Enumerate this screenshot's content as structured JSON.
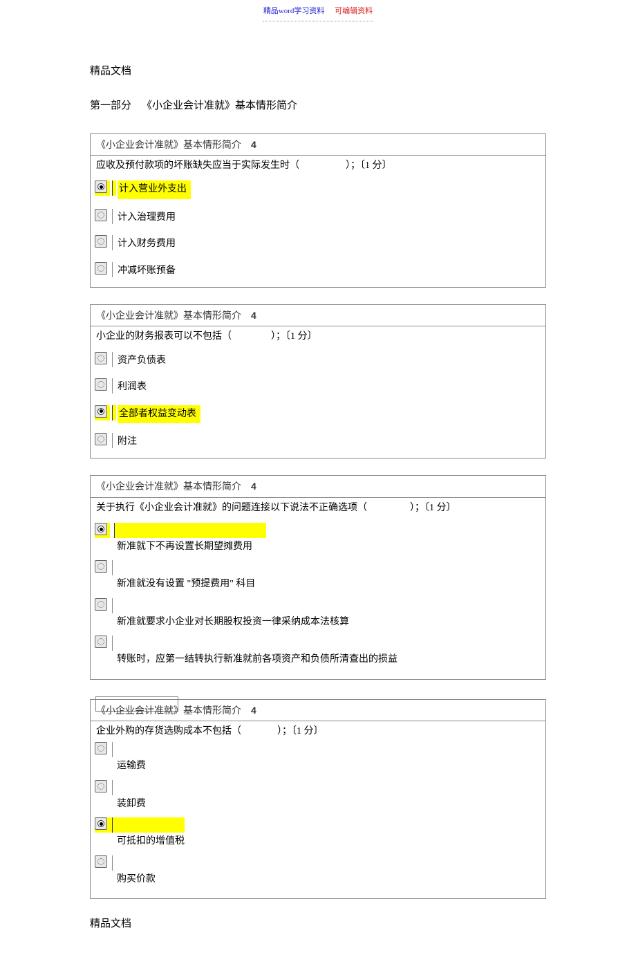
{
  "banner": {
    "left": "精品word学习资料",
    "right": "可编辑资料"
  },
  "doc_header": "精品文档",
  "section_title_prefix": "第一部分",
  "section_title_main": "《小企业会计准就》基本情形简介",
  "doc_footer": "精品文档",
  "questions": [
    {
      "category_label": "《小企业会计准就》基本情形简介",
      "category_badge": "4",
      "text_prefix": "应收及预付款项的坏账缺失应当于实际发生时（",
      "text_suffix": "）；〔1 分〕",
      "layout": "inline",
      "options": [
        {
          "label": "计入营业外支出",
          "selected": true,
          "highlight": true
        },
        {
          "label": "计入治理费用",
          "selected": false,
          "highlight": false
        },
        {
          "label": "计入财务费用",
          "selected": false,
          "highlight": false
        },
        {
          "label": "冲减坏账预备",
          "selected": false,
          "highlight": false
        }
      ]
    },
    {
      "category_label": "《小企业会计准就》基本情形简介",
      "category_badge": "4",
      "text_prefix": "小企业的财务报表可以不包括（",
      "text_suffix": "）；〔1 分〕",
      "layout": "inline",
      "options": [
        {
          "label": "资产负债表",
          "selected": false,
          "highlight": false
        },
        {
          "label": "利润表",
          "selected": false,
          "highlight": false
        },
        {
          "label": "全部者权益变动表",
          "selected": true,
          "highlight": true
        },
        {
          "label": "附注",
          "selected": false,
          "highlight": false
        }
      ]
    },
    {
      "category_label": "《小企业会计准就》基本情形简介",
      "category_badge": "4",
      "text_prefix": "关于执行《小企业会计准就》的问题连接以下说法不正确选项（",
      "text_suffix": "）；〔1 分〕",
      "layout": "stack",
      "options": [
        {
          "label": "新准就下不再设置长期望摊费用",
          "selected": true,
          "highlight": true
        },
        {
          "label": "新准就没有设置 \"预提费用\" 科目",
          "selected": false,
          "highlight": false
        },
        {
          "label": "新准就要求小企业对长期股权投资一律采纳成本法核算",
          "selected": false,
          "highlight": false
        },
        {
          "label": "转账时，应第一结转执行新准就前各项资产和负债所清查出的损益",
          "selected": false,
          "highlight": false
        }
      ]
    },
    {
      "category_label": "《小企业会计准就》基本情形简介",
      "category_badge": "4",
      "text_prefix": "企业外购的存货选购成本不包括（",
      "text_suffix": "）；〔1 分〕",
      "layout": "stack",
      "pre_spacer_box": true,
      "options": [
        {
          "label": "运输费",
          "selected": false,
          "highlight": false
        },
        {
          "label": "装卸费",
          "selected": false,
          "highlight": false
        },
        {
          "label": "可抵扣的增值税",
          "selected": true,
          "highlight": true
        },
        {
          "label": "购买价款",
          "selected": false,
          "highlight": false
        }
      ]
    }
  ]
}
